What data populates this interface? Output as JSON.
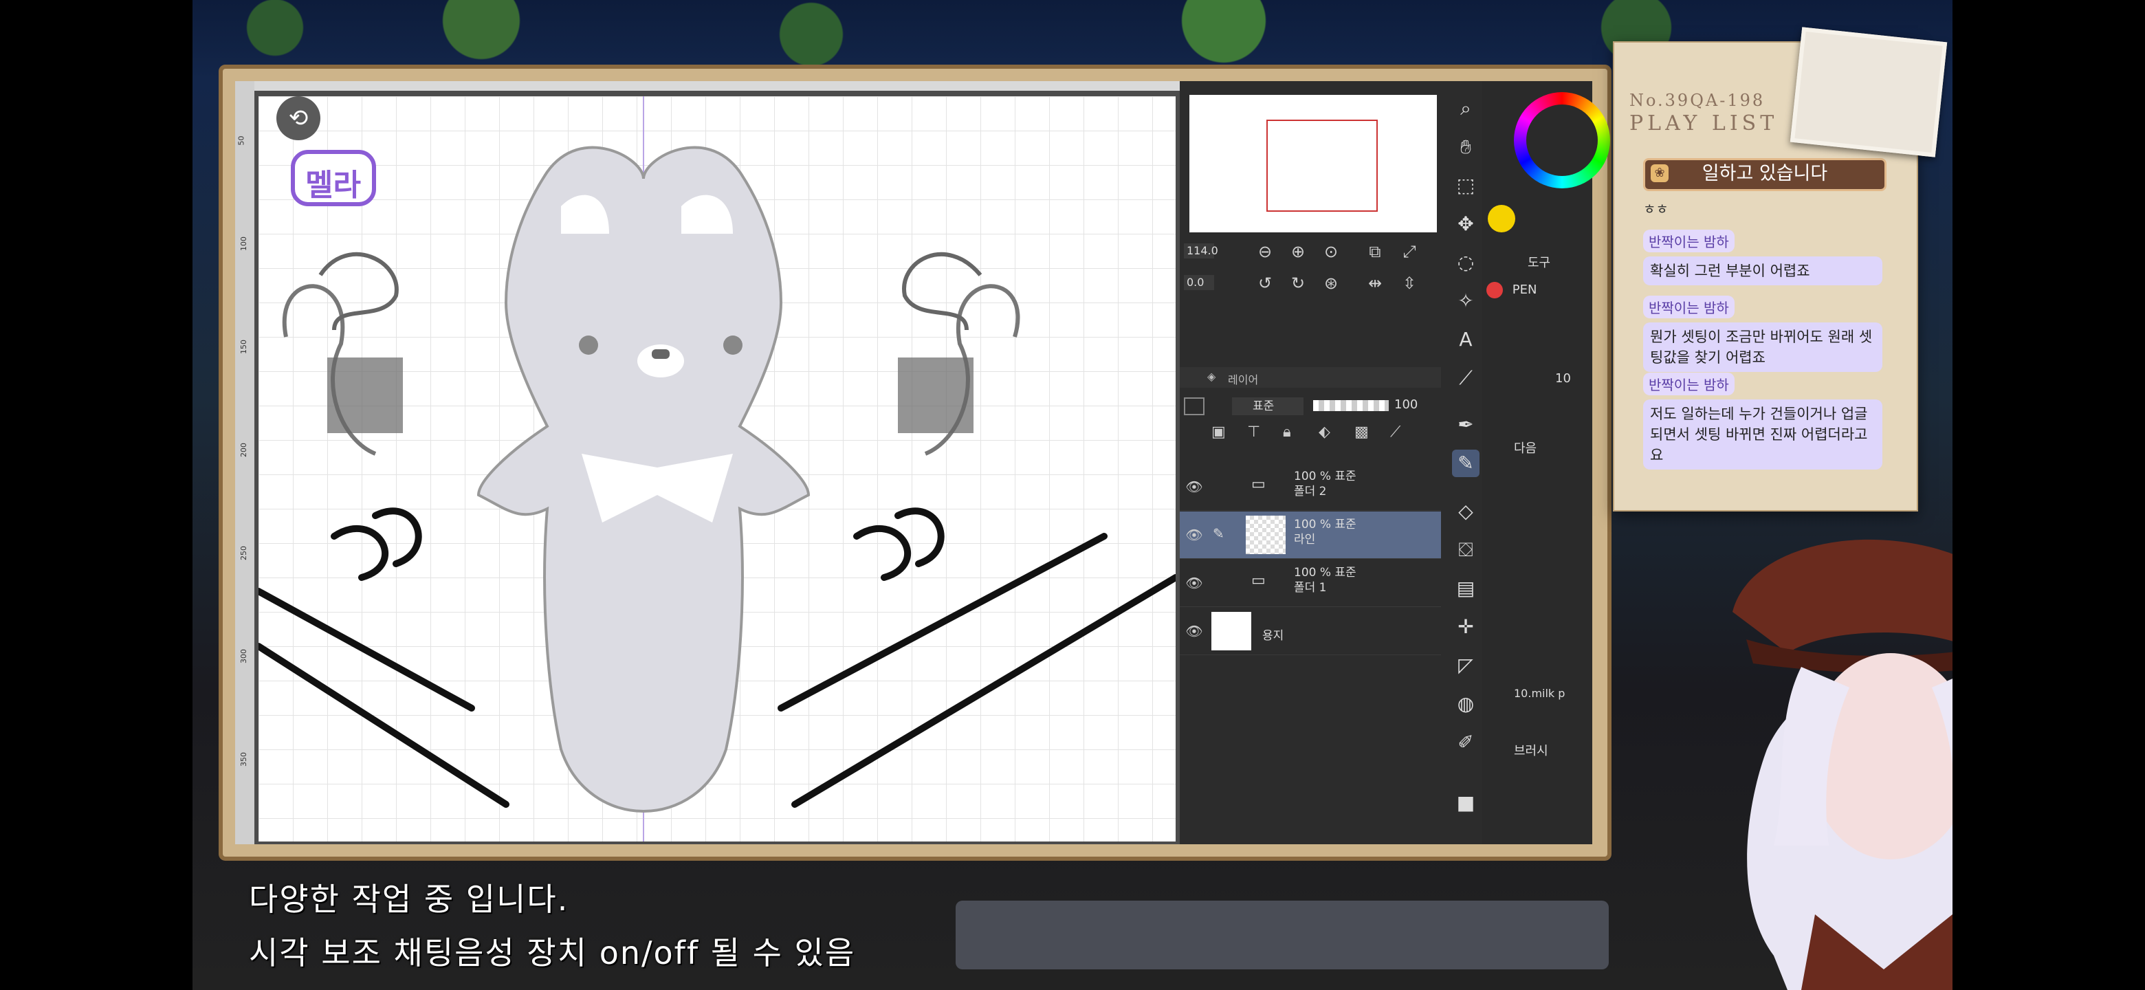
{
  "canvas": {
    "rotate_icon": "rotate-icon",
    "ruler_marks": [
      "50",
      "100",
      "150",
      "200",
      "250",
      "300",
      "350"
    ],
    "badge_text": "멜라"
  },
  "navigator": {
    "zoom_value": "114.0",
    "angle_value": "0.0"
  },
  "layers": {
    "tab_label": "레이어",
    "blend_mode": "표준",
    "opacity": "100",
    "rows": [
      {
        "opacity_mode": "100 % 표준",
        "name": "폴더 2",
        "type": "folder"
      },
      {
        "opacity_mode": "100 % 표준",
        "name": "라인",
        "type": "raster",
        "selected": true
      },
      {
        "opacity_mode": "100 % 표준",
        "name": "폴더 1",
        "type": "folder"
      },
      {
        "opacity_mode": "",
        "name": "용지",
        "type": "paper"
      }
    ]
  },
  "color_panel": {
    "tab_label": "도구",
    "pen_label": "PEN",
    "brush_size": "10",
    "add_label": "다음",
    "brush_name": "10.milk p",
    "brush_label": "브러시"
  },
  "playlist": {
    "code": "No.39QA-198",
    "title": "PLAY LIST",
    "status": "일하고 있습니다",
    "top_partial": "ㅎㅎ",
    "chats": [
      {
        "name": "반짝이는 밤하",
        "msg": "확실히 그런 부분이 어렵죠"
      },
      {
        "name": "반짝이는 밤하",
        "msg": "뭔가 셋팅이 조금만 바뀌어도 원래 셋팅값을 찾기 어렵죠"
      },
      {
        "name": "반짝이는 밤하",
        "msg": "저도 일하는데 누가 건들이거나 업글되면서 셋팅 바뀌면 진짜 어렵더라고요"
      }
    ]
  },
  "subtitles": {
    "line1": "다양한 작업 중 입니다.",
    "line2": "시각 보조 채팅음성 장치 on/off 될 수 있음"
  },
  "colors": {
    "accent": "#5b6b8a",
    "chat_bg": "#ded6fb",
    "status_bg": "#6b4530"
  }
}
